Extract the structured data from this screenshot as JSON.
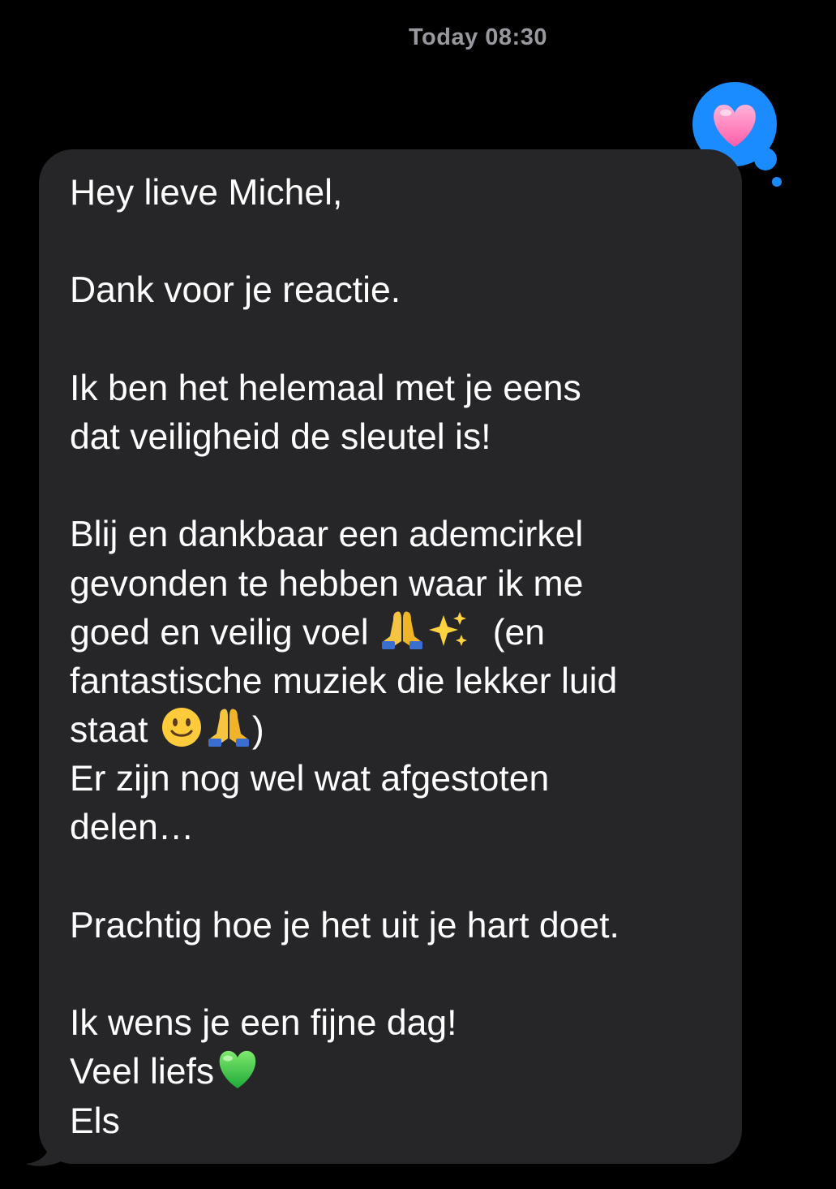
{
  "conversation": {
    "timestamp": "Today 08:30",
    "reaction_icon": "heart-icon",
    "colors": {
      "background": "#000000",
      "bubble": "#262629",
      "reaction_bubble": "#1a8cff",
      "timestamp_text": "#98989f",
      "message_text": "#ffffff"
    }
  },
  "message": {
    "lines": [
      "Hey lieve Michel,",
      "",
      "Dank voor je reactie.",
      "",
      "Ik ben het helemaal met je eens",
      "dat veiligheid de sleutel is!",
      "",
      "Blij en dankbaar een ademcirkel",
      "gevonden te hebben waar ik me",
      "goed en veilig voel",
      "(en",
      "fantastische muziek die lekker luid",
      "staat",
      ")",
      "Er zijn nog wel wat afgestoten",
      "delen…",
      "",
      "Prachtig hoe je het uit je hart doet.",
      "",
      "Ik wens je een fijne dag!",
      "Veel liefs",
      "Els"
    ],
    "emojis": {
      "pray": "folded-hands-icon",
      "sparkles": "sparkles-icon",
      "smile": "slightly-smiling-face-icon",
      "green_heart": "green-heart-icon"
    }
  }
}
